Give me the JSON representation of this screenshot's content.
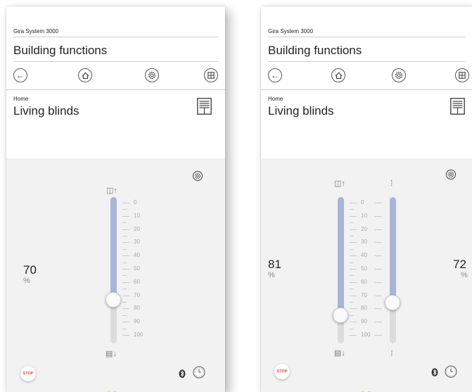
{
  "screens": [
    {
      "system_label": "Gira System 3000",
      "title": "Building functions",
      "nav": [
        "back-icon",
        "home-icon",
        "settings-icon",
        "grid-icon"
      ],
      "breadcrumb": "Home",
      "room": "Living blinds",
      "position_value": "70",
      "position_unit": "%",
      "position_fraction": 0.7,
      "scale": [
        "0",
        "10",
        "20",
        "30",
        "40",
        "50",
        "60",
        "70",
        "80",
        "90",
        "100"
      ],
      "stop_label": "STOP",
      "page_dots": [
        "active",
        "inactive"
      ]
    },
    {
      "system_label": "Gira System 3000",
      "title": "Building functions",
      "nav": [
        "back-icon",
        "home-icon",
        "settings-icon",
        "grid-icon"
      ],
      "breadcrumb": "Home",
      "room": "Living blinds",
      "position_value": "81",
      "position_unit": "%",
      "position_fraction": 0.81,
      "slat_value": "72",
      "slat_unit": "%",
      "slat_fraction": 0.72,
      "scale": [
        "0",
        "10",
        "20",
        "30",
        "40",
        "50",
        "60",
        "70",
        "80",
        "90",
        "100"
      ],
      "stop_label": "STOP",
      "page_dots": [
        "active",
        "inactive"
      ]
    }
  ],
  "colors": {
    "accent_fill": "#aab4d8",
    "stop_red": "#e0463a",
    "active_dot": "#f0d84a",
    "inactive_dot": "#c8c8c8"
  }
}
